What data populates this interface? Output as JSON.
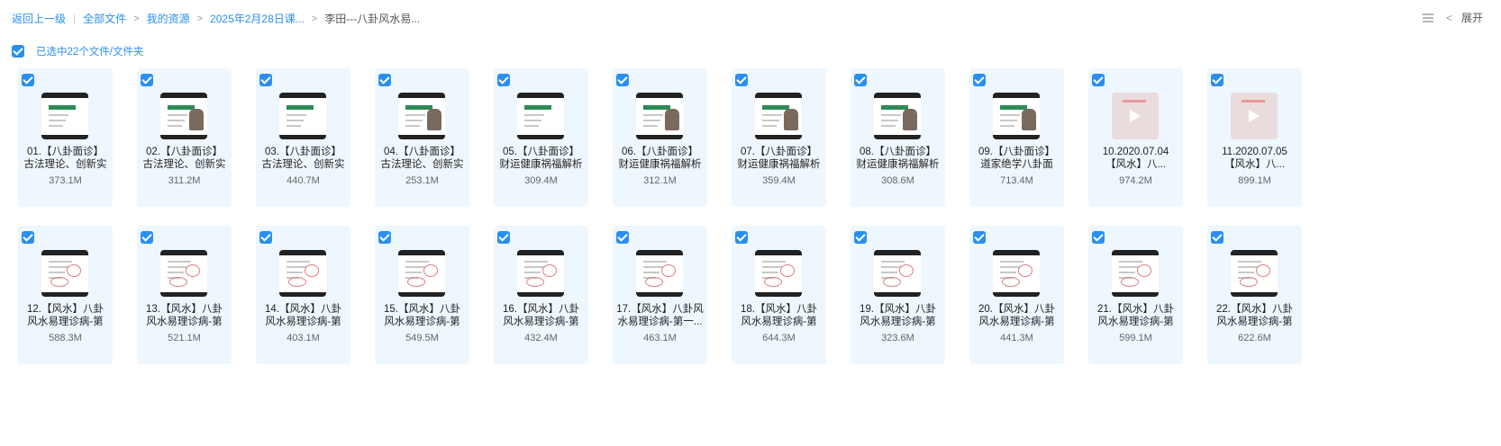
{
  "breadcrumb": {
    "back": "返回上一级",
    "all_files": "全部文件",
    "my_resources": "我的资源",
    "folder_date": "2025年2月28日课...",
    "current": "李田---八卦风水易..."
  },
  "topbar": {
    "expand_label": "展开"
  },
  "selection": {
    "label": "已选中22个文件/文件夹"
  },
  "files": [
    {
      "line1": "01.【八卦面诊】",
      "line2": "古法理论、创新实",
      "size": "373.1M",
      "thumb": "slide"
    },
    {
      "line1": "02.【八卦面诊】",
      "line2": "古法理论、创新实",
      "size": "311.2M",
      "thumb": "slide"
    },
    {
      "line1": "03.【八卦面诊】",
      "line2": "古法理论、创新实",
      "size": "440.7M",
      "thumb": "slide"
    },
    {
      "line1": "04.【八卦面诊】",
      "line2": "古法理论、创新实",
      "size": "253.1M",
      "thumb": "slide"
    },
    {
      "line1": "05.【八卦面诊】",
      "line2": "财运健康祸福解析",
      "size": "309.4M",
      "thumb": "slide"
    },
    {
      "line1": "06.【八卦面诊】",
      "line2": "财运健康祸福解析",
      "size": "312.1M",
      "thumb": "slide"
    },
    {
      "line1": "07.【八卦面诊】",
      "line2": "财运健康祸福解析",
      "size": "359.4M",
      "thumb": "slide"
    },
    {
      "line1": "08.【八卦面诊】",
      "line2": "财运健康祸福解析",
      "size": "308.6M",
      "thumb": "slide"
    },
    {
      "line1": "09.【八卦面诊】",
      "line2": "道家绝学八卦面",
      "size": "713.4M",
      "thumb": "slide"
    },
    {
      "line1": "10.2020.07.04",
      "line2": "【风水】八...",
      "size": "974.2M",
      "thumb": "video"
    },
    {
      "line1": "11.2020.07.05",
      "line2": "【风水】八...",
      "size": "899.1M",
      "thumb": "video"
    },
    {
      "line1": "12.【风水】八卦",
      "line2": "风水易理诊病-第",
      "size": "588.3M",
      "thumb": "hand"
    },
    {
      "line1": "13.【风水】八卦",
      "line2": "风水易理诊病-第",
      "size": "521.1M",
      "thumb": "hand"
    },
    {
      "line1": "14.【风水】八卦",
      "line2": "风水易理诊病-第",
      "size": "403.1M",
      "thumb": "hand"
    },
    {
      "line1": "15.【风水】八卦",
      "line2": "风水易理诊病-第",
      "size": "549.5M",
      "thumb": "hand"
    },
    {
      "line1": "16.【风水】八卦",
      "line2": "风水易理诊病-第",
      "size": "432.4M",
      "thumb": "hand"
    },
    {
      "line1": "17.【风水】八卦风",
      "line2": "水易理诊病-第一...",
      "size": "463.1M",
      "thumb": "hand"
    },
    {
      "line1": "18.【风水】八卦",
      "line2": "风水易理诊病-第",
      "size": "644.3M",
      "thumb": "hand"
    },
    {
      "line1": "19.【风水】八卦",
      "line2": "风水易理诊病-第",
      "size": "323.6M",
      "thumb": "hand"
    },
    {
      "line1": "20.【风水】八卦",
      "line2": "风水易理诊病-第",
      "size": "441.3M",
      "thumb": "hand"
    },
    {
      "line1": "21.【风水】八卦",
      "line2": "风水易理诊病-第",
      "size": "599.1M",
      "thumb": "hand"
    },
    {
      "line1": "22.【风水】八卦",
      "line2": "风水易理诊病-第",
      "size": "622.6M",
      "thumb": "hand"
    }
  ],
  "colors": {
    "accent": "#2a8ff0",
    "card_bg": "#eef7fe"
  }
}
